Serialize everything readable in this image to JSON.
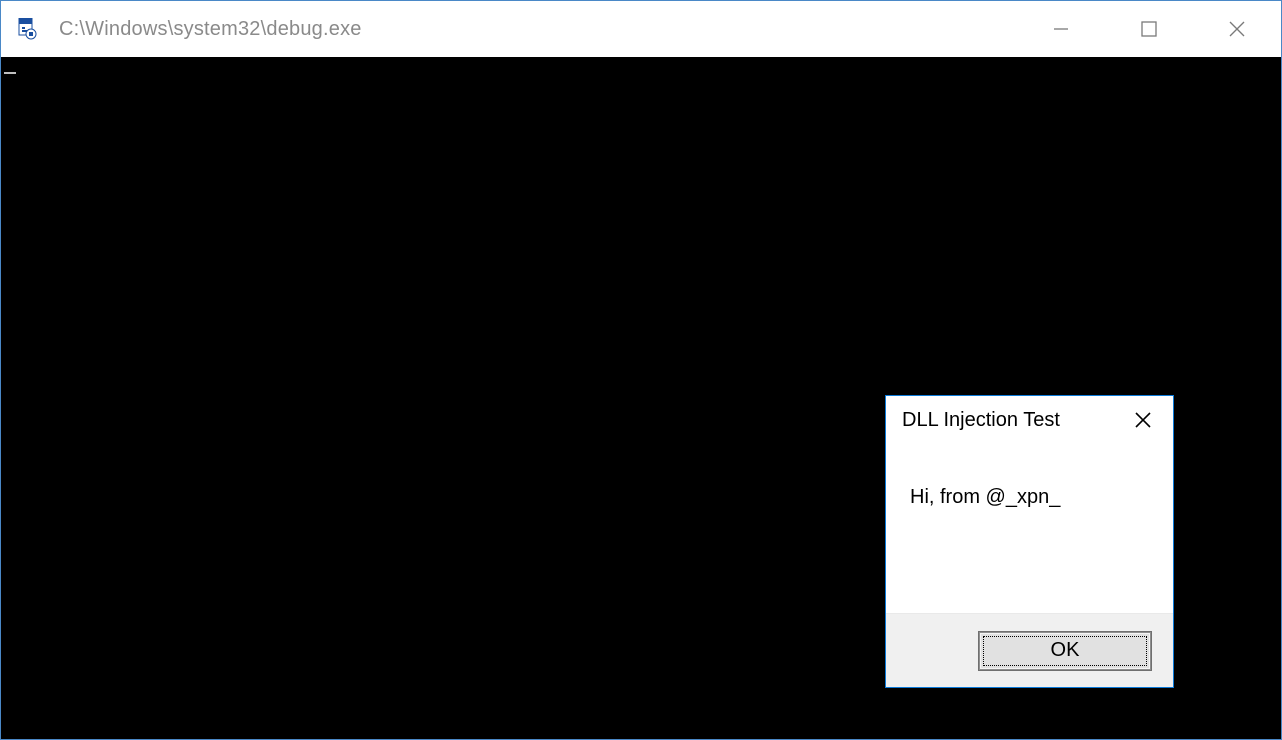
{
  "main_window": {
    "title": "C:\\Windows\\system32\\debug.exe",
    "console_output": ""
  },
  "dialog": {
    "title": "DLL Injection Test",
    "message": "Hi, from @_xpn_",
    "ok_label": "OK"
  }
}
